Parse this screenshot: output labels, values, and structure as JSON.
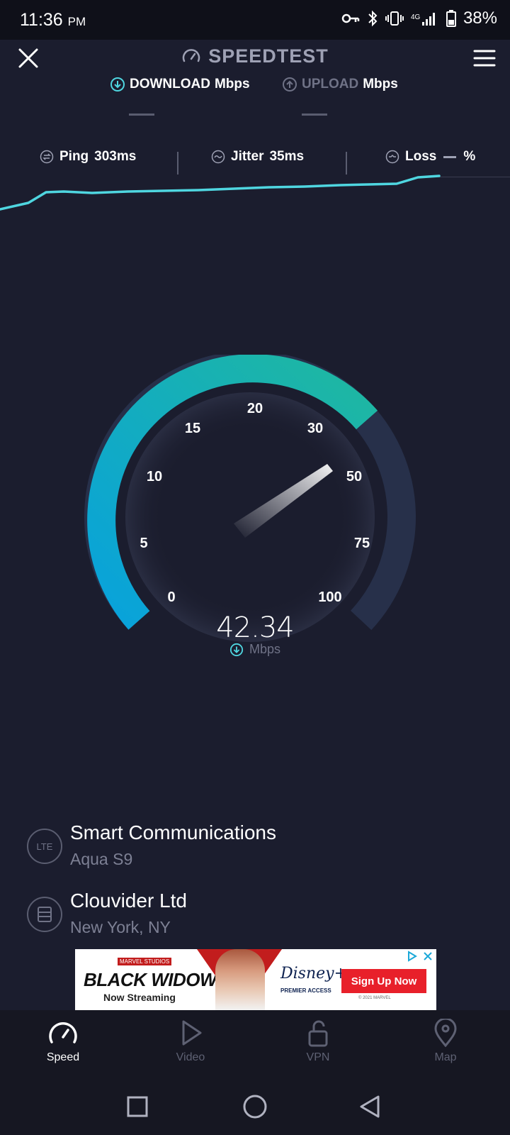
{
  "status_bar": {
    "time": "11:36",
    "ampm": "PM",
    "battery": "38%",
    "icons": [
      "vpn-key-icon",
      "bluetooth-icon",
      "vibrate-icon",
      "signal-icon",
      "battery-icon"
    ]
  },
  "header": {
    "title": "SPEEDTEST"
  },
  "metrics": {
    "download_label": "DOWNLOAD",
    "download_unit": "Mbps",
    "upload_label": "UPLOAD",
    "upload_unit": "Mbps"
  },
  "ping_row": {
    "ping_label": "Ping",
    "ping_value": "303ms",
    "jitter_label": "Jitter",
    "jitter_value": "35ms",
    "loss_label": "Loss",
    "loss_value": "%"
  },
  "gauge": {
    "ticks": [
      "0",
      "5",
      "10",
      "15",
      "20",
      "30",
      "50",
      "75",
      "100"
    ],
    "current_value": "42.34",
    "unit": "Mbps",
    "accent_start": "#08a2dc",
    "accent_end": "#1fb8a0"
  },
  "provider": {
    "isp_badge": "LTE",
    "isp_name": "Smart Communications",
    "isp_device": "Aqua S9",
    "server_name": "Clouvider Ltd",
    "server_location": "New York, NY"
  },
  "ad": {
    "studio": "MARVEL STUDIOS",
    "title": "BLACK WIDOW",
    "subtitle": "Now Streaming",
    "brand": "Disney+",
    "brand_sub": "PREMIER ACCESS",
    "cta": "Sign Up Now",
    "copyright": "© 2021 MARVEL"
  },
  "bottom_nav": {
    "speed": "Speed",
    "video": "Video",
    "vpn": "VPN",
    "map": "Map"
  },
  "colors": {
    "background": "#1b1d2e",
    "accent": "#4fd6e0"
  }
}
